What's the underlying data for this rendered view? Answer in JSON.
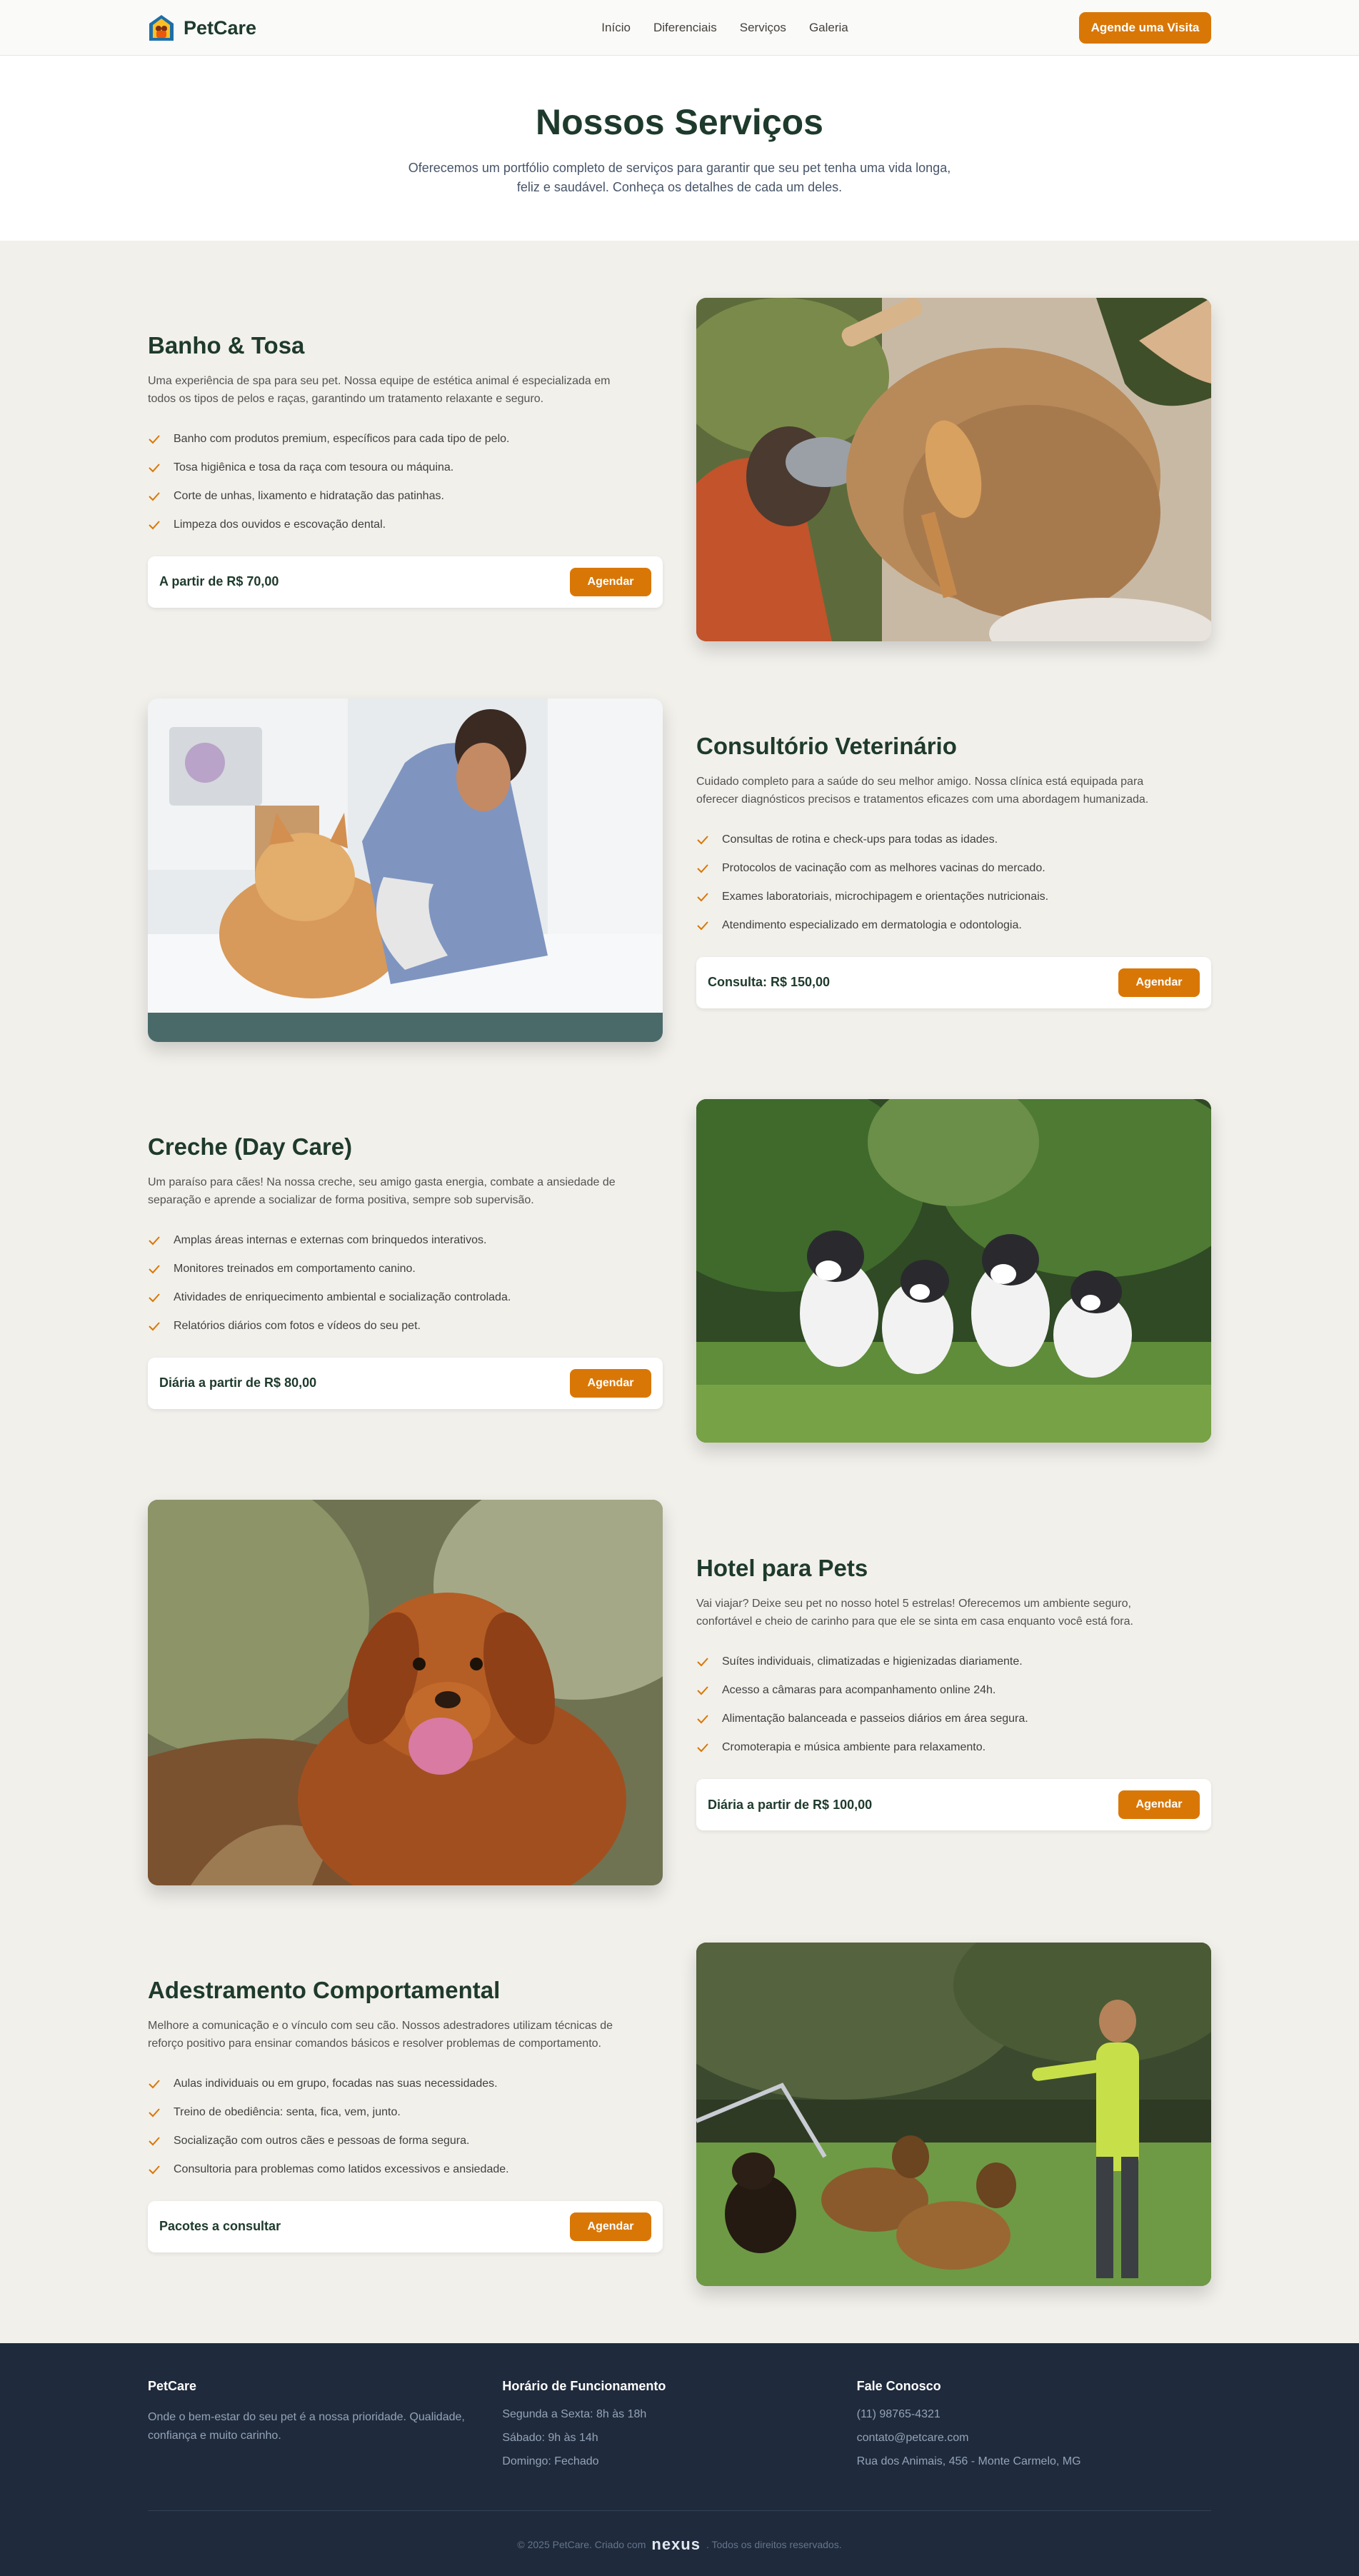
{
  "header": {
    "brand": "PetCare",
    "nav": [
      "Início",
      "Diferenciais",
      "Serviços",
      "Galeria"
    ],
    "cta": "Agende uma Visita"
  },
  "hero": {
    "title": "Nossos Serviços",
    "subtitle": "Oferecemos um portfólio completo de serviços para garantir que seu pet tenha uma vida longa, feliz e saudável. Conheça os detalhes de cada um deles."
  },
  "services": [
    {
      "title": "Banho & Tosa",
      "description": "Uma experiência de spa para seu pet. Nossa equipe de estética animal é especializada em todos os tipos de pelos e raças, garantindo um tratamento relaxante e seguro.",
      "features": [
        "Banho com produtos premium, específicos para cada tipo de pelo.",
        "Tosa higiênica e tosa da raça com tesoura ou máquina.",
        "Corte de unhas, lixamento e hidratação das patinhas.",
        "Limpeza dos ouvidos e escovação dental."
      ],
      "price": "A partir de R$ 70,00",
      "button": "Agendar"
    },
    {
      "title": "Consultório Veterinário",
      "description": "Cuidado completo para a saúde do seu melhor amigo. Nossa clínica está equipada para oferecer diagnósticos precisos e tratamentos eficazes com uma abordagem humanizada.",
      "features": [
        "Consultas de rotina e check-ups para todas as idades.",
        "Protocolos de vacinação com as melhores vacinas do mercado.",
        "Exames laboratoriais, microchipagem e orientações nutricionais.",
        "Atendimento especializado em dermatologia e odontologia."
      ],
      "price": "Consulta: R$ 150,00",
      "button": "Agendar"
    },
    {
      "title": "Creche (Day Care)",
      "description": "Um paraíso para cães! Na nossa creche, seu amigo gasta energia, combate a ansiedade de separação e aprende a socializar de forma positiva, sempre sob supervisão.",
      "features": [
        "Amplas áreas internas e externas com brinquedos interativos.",
        "Monitores treinados em comportamento canino.",
        "Atividades de enriquecimento ambiental e socialização controlada.",
        "Relatórios diários com fotos e vídeos do seu pet."
      ],
      "price": "Diária a partir de R$ 80,00",
      "button": "Agendar"
    },
    {
      "title": "Hotel para Pets",
      "description": "Vai viajar? Deixe seu pet no nosso hotel 5 estrelas! Oferecemos um ambiente seguro, confortável e cheio de carinho para que ele se sinta em casa enquanto você está fora.",
      "features": [
        "Suítes individuais, climatizadas e higienizadas diariamente.",
        "Acesso a câmaras para acompanhamento online 24h.",
        "Alimentação balanceada e passeios diários em área segura.",
        "Cromoterapia e música ambiente para relaxamento."
      ],
      "price": "Diária a partir de R$ 100,00",
      "button": "Agendar"
    },
    {
      "title": "Adestramento Comportamental",
      "description": "Melhore a comunicação e o vínculo com seu cão. Nossos adestradores utilizam técnicas de reforço positivo para ensinar comandos básicos e resolver problemas de comportamento.",
      "features": [
        "Aulas individuais ou em grupo, focadas nas suas necessidades.",
        "Treino de obediência: senta, fica, vem, junto.",
        "Socialização com outros cães e pessoas de forma segura.",
        "Consultoria para problemas como latidos excessivos e ansiedade."
      ],
      "price": "Pacotes a consultar",
      "button": "Agendar"
    }
  ],
  "footer": {
    "about_title": "PetCare",
    "about_text": "Onde o bem-estar do seu pet é a nossa prioridade. Qualidade, confiança e muito carinho.",
    "hours_title": "Horário de Funcionamento",
    "hours": [
      "Segunda a Sexta: 8h às 18h",
      "Sábado: 9h às 14h",
      "Domingo: Fechado"
    ],
    "contact_title": "Fale Conosco",
    "contact": [
      "(11) 98765-4321",
      "contato@petcare.com",
      "Rua dos Animais, 456 - Monte Carmelo, MG"
    ],
    "copyright_prefix": "© 2025 PetCare. Criado com",
    "nexus_logo": "nexus",
    "copyright_suffix": ". Todos os direitos reservados."
  },
  "colors": {
    "accent": "#d97706",
    "brand_dark": "#1e3a2c",
    "section_bg": "#f2f0eb",
    "footer_bg": "#1f2a3c"
  }
}
